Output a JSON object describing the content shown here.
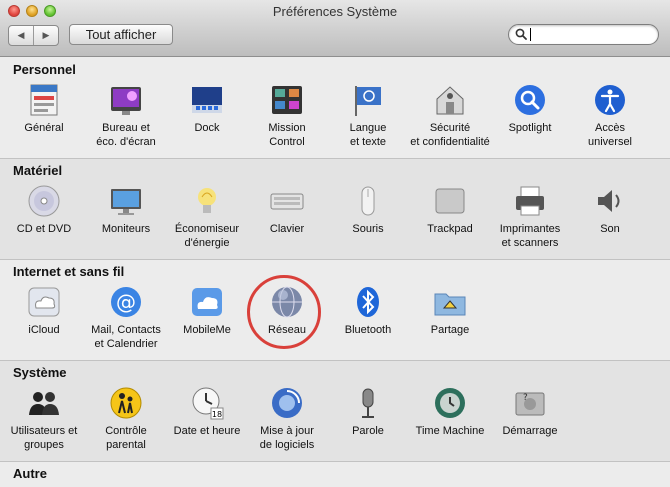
{
  "window": {
    "title": "Préférences Système",
    "show_all_label": "Tout afficher",
    "back_arrow": "◀",
    "forward_arrow": "▶",
    "search": {
      "placeholder": "",
      "value": ""
    }
  },
  "sections": [
    {
      "title": "Personnel",
      "items": [
        {
          "label": "Général"
        },
        {
          "label": "Bureau et\néco. d'écran"
        },
        {
          "label": "Dock"
        },
        {
          "label": "Mission\nControl"
        },
        {
          "label": "Langue\net texte"
        },
        {
          "label": "Sécurité\net confidentialité"
        },
        {
          "label": "Spotlight"
        },
        {
          "label": "Accès\nuniversel"
        }
      ]
    },
    {
      "title": "Matériel",
      "items": [
        {
          "label": "CD et DVD"
        },
        {
          "label": "Moniteurs"
        },
        {
          "label": "Économiseur\nd'énergie"
        },
        {
          "label": "Clavier"
        },
        {
          "label": "Souris"
        },
        {
          "label": "Trackpad"
        },
        {
          "label": "Imprimantes\net scanners"
        },
        {
          "label": "Son"
        }
      ]
    },
    {
      "title": "Internet et sans fil",
      "items": [
        {
          "label": "iCloud"
        },
        {
          "label": "Mail, Contacts\net Calendrier"
        },
        {
          "label": "MobileMe"
        },
        {
          "label": "Réseau"
        },
        {
          "label": "Bluetooth"
        },
        {
          "label": "Partage"
        }
      ]
    },
    {
      "title": "Système",
      "items": [
        {
          "label": "Utilisateurs et\ngroupes"
        },
        {
          "label": "Contrôle\nparental"
        },
        {
          "label": "Date et heure"
        },
        {
          "label": "Mise à jour\nde logiciels"
        },
        {
          "label": "Parole"
        },
        {
          "label": "Time Machine"
        },
        {
          "label": "Démarrage"
        }
      ]
    },
    {
      "title": "Autre",
      "items": []
    }
  ],
  "icons": {
    "Personnel": [
      "general-icon",
      "desktop-screensaver-icon",
      "dock-icon",
      "mission-control-icon",
      "language-flag-icon",
      "security-house-icon",
      "spotlight-magnifier-icon",
      "accessibility-icon"
    ],
    "Matériel": [
      "cd-dvd-icon",
      "display-monitor-icon",
      "energy-bulb-icon",
      "keyboard-icon",
      "mouse-icon",
      "trackpad-icon",
      "printer-icon",
      "speaker-icon"
    ],
    "Internet et sans fil": [
      "icloud-icon",
      "mail-at-icon",
      "mobileme-cloud-icon",
      "network-globe-icon",
      "bluetooth-icon",
      "sharing-folder-icon"
    ],
    "Système": [
      "users-groups-icon",
      "parental-controls-icon",
      "date-time-clock-icon",
      "software-update-icon",
      "speech-mic-icon",
      "time-machine-icon",
      "startup-disk-icon"
    ]
  }
}
